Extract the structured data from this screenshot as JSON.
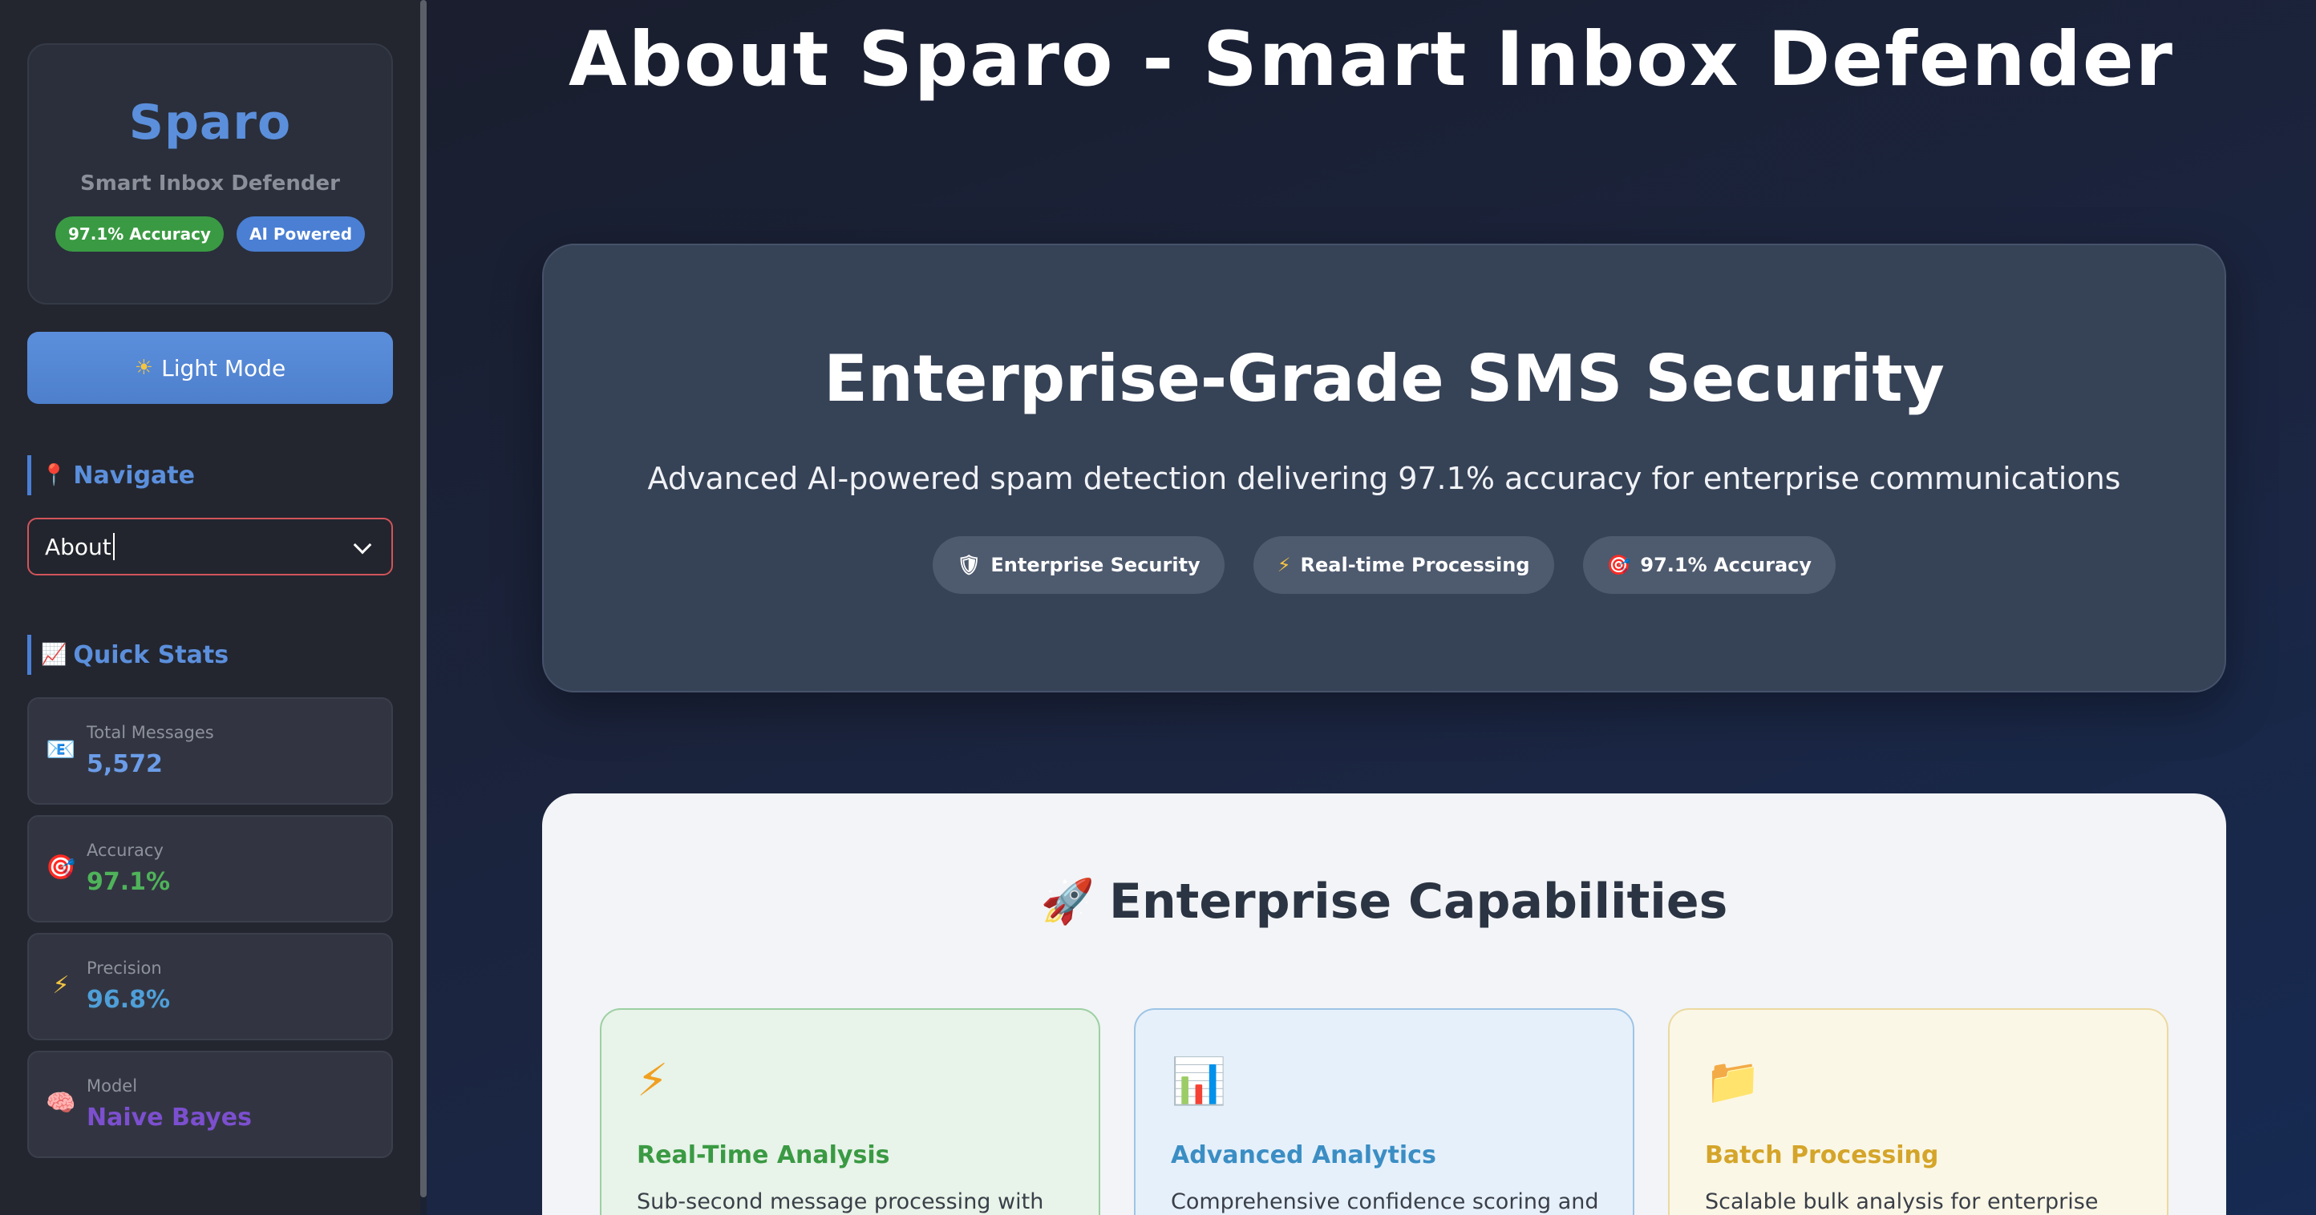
{
  "sidebar": {
    "brand": {
      "title": "Sparo",
      "subtitle": "Smart Inbox Defender",
      "badges": [
        "97.1% Accuracy",
        "AI Powered"
      ]
    },
    "theme_button": {
      "icon": "sun-icon",
      "label": "Light Mode"
    },
    "navigate": {
      "label": "Navigate",
      "icon": "pin-icon",
      "selected": "About"
    },
    "quick_stats": {
      "label": "Quick Stats",
      "icon": "chart-increasing-icon",
      "items": [
        {
          "icon": "envelope-icon",
          "label": "Total Messages",
          "value": "5,572",
          "color": "#6b9ce8"
        },
        {
          "icon": "target-icon",
          "label": "Accuracy",
          "value": "97.1%",
          "color": "#4fb35a"
        },
        {
          "icon": "lightning-icon",
          "label": "Precision",
          "value": "96.8%",
          "color": "#4f9fd8"
        },
        {
          "icon": "brain-icon",
          "label": "Model",
          "value": "Naive Bayes",
          "color": "#7c4fcf"
        }
      ]
    }
  },
  "main": {
    "page_title": "About Sparo - Smart Inbox Defender",
    "hero": {
      "title": "Enterprise-Grade SMS Security",
      "subtitle": "Advanced AI-powered spam detection delivering 97.1% accuracy for enterprise communications",
      "pills": [
        {
          "icon": "shield-icon",
          "label": "Enterprise Security"
        },
        {
          "icon": "lightning-icon",
          "label": "Real-time Processing"
        },
        {
          "icon": "target-icon",
          "label": "97.1% Accuracy"
        }
      ]
    },
    "capabilities": {
      "title": "Enterprise Capabilities",
      "icon": "rocket-icon",
      "cards": [
        {
          "icon": "lightning-icon",
          "title": "Real-Time Analysis",
          "description": "Sub-second message processing with",
          "color": "#3a9a43"
        },
        {
          "icon": "bar-chart-icon",
          "title": "Advanced Analytics",
          "description": "Comprehensive confidence scoring and",
          "color": "#3b8ec4"
        },
        {
          "icon": "folder-icon",
          "title": "Batch Processing",
          "description": "Scalable bulk analysis for enterprise",
          "color": "#d4a52a"
        }
      ]
    }
  }
}
